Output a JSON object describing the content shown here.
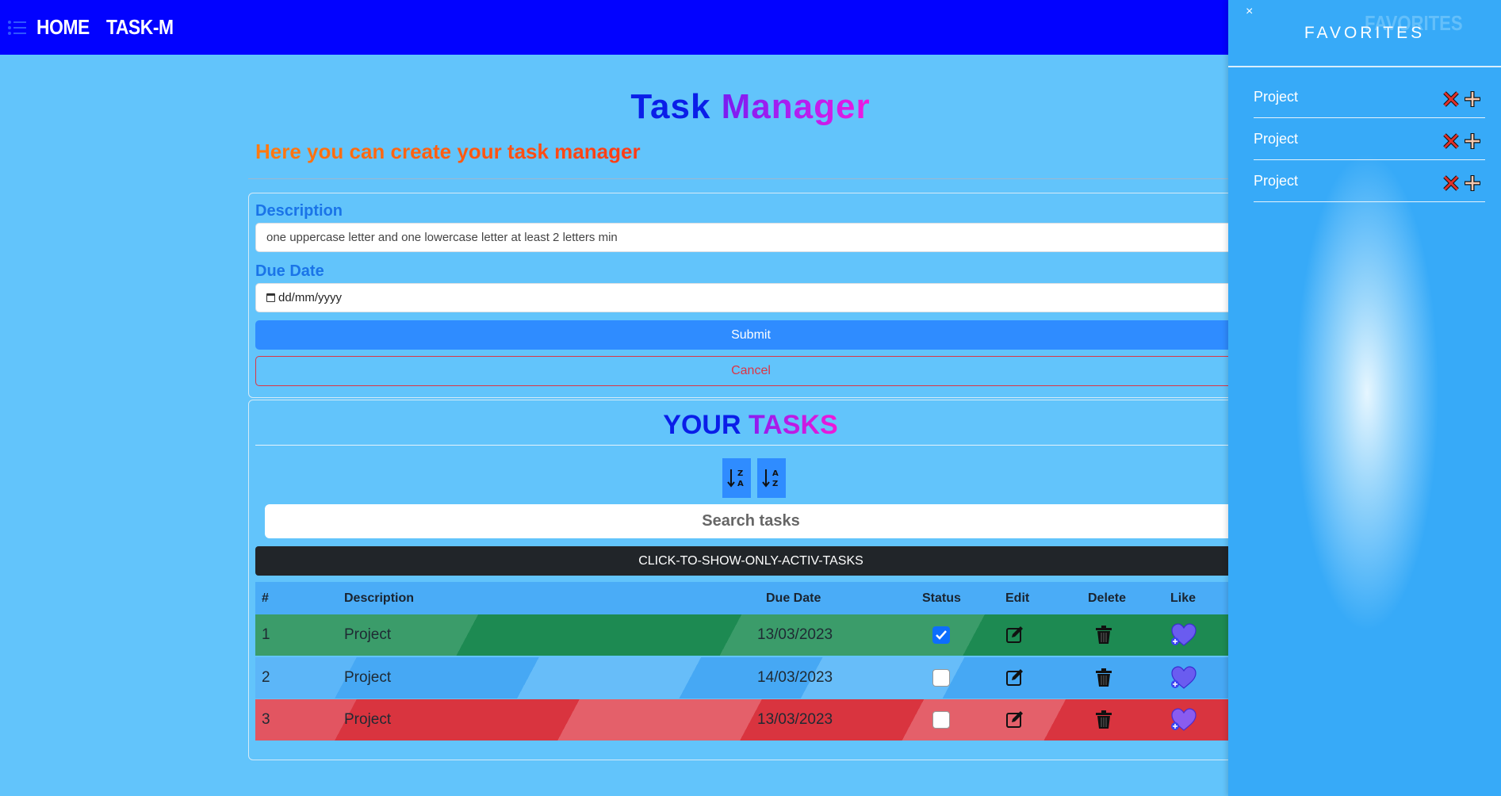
{
  "nav": {
    "home_label": "HOME",
    "brand_label": "TASK-M"
  },
  "header": {
    "title_part1": "Task",
    "title_part2": "Manager",
    "subtitle": "Here you can create your task manager"
  },
  "form": {
    "description_label": "Description",
    "description_placeholder": "one uppercase letter and one lowercase letter at least 2 letters min",
    "due_date_label": "Due Date",
    "due_date_placeholder": "dd/mm/yyyy",
    "submit_label": "Submit",
    "cancel_label": "Cancel"
  },
  "tasks": {
    "title_part1": "YOUR",
    "title_part2": "TASKS",
    "search_placeholder": "Search tasks",
    "active_filter_label": "CLICK-TO-SHOW-ONLY-ACTIV-TASKS",
    "columns": {
      "num": "#",
      "description": "Description",
      "due_date": "Due Date",
      "status": "Status",
      "edit": "Edit",
      "delete": "Delete",
      "like": "Like"
    },
    "rows": [
      {
        "num": "1",
        "description": "Project",
        "due_date": "13/03/2023",
        "done": true,
        "color": "#1d8a52"
      },
      {
        "num": "2",
        "description": "Project",
        "due_date": "14/03/2023",
        "done": false,
        "color": "#46a8f4"
      },
      {
        "num": "3",
        "description": "Project",
        "due_date": "13/03/2023",
        "done": false,
        "color": "#d9343f"
      }
    ]
  },
  "sidebar": {
    "close_glyph": "×",
    "ghost_label": "FAVORITES",
    "title": "FAVORITES",
    "items": [
      {
        "label": "Project"
      },
      {
        "label": "Project"
      },
      {
        "label": "Project"
      }
    ]
  },
  "colors": {
    "nav_bg": "#0202ff",
    "page_bg": "#62c4fb",
    "primary": "#2f8cff",
    "danger": "#dc3545",
    "dark": "#212529"
  },
  "icons": {
    "menu": "list-icon",
    "sort_desc": "sort-alpha-down-alt-icon",
    "sort_asc": "sort-alpha-down-icon",
    "edit": "pencil-square-icon",
    "delete": "trash-icon",
    "like": "heart-plus-icon",
    "remove": "x-icon",
    "add": "plus-icon"
  }
}
